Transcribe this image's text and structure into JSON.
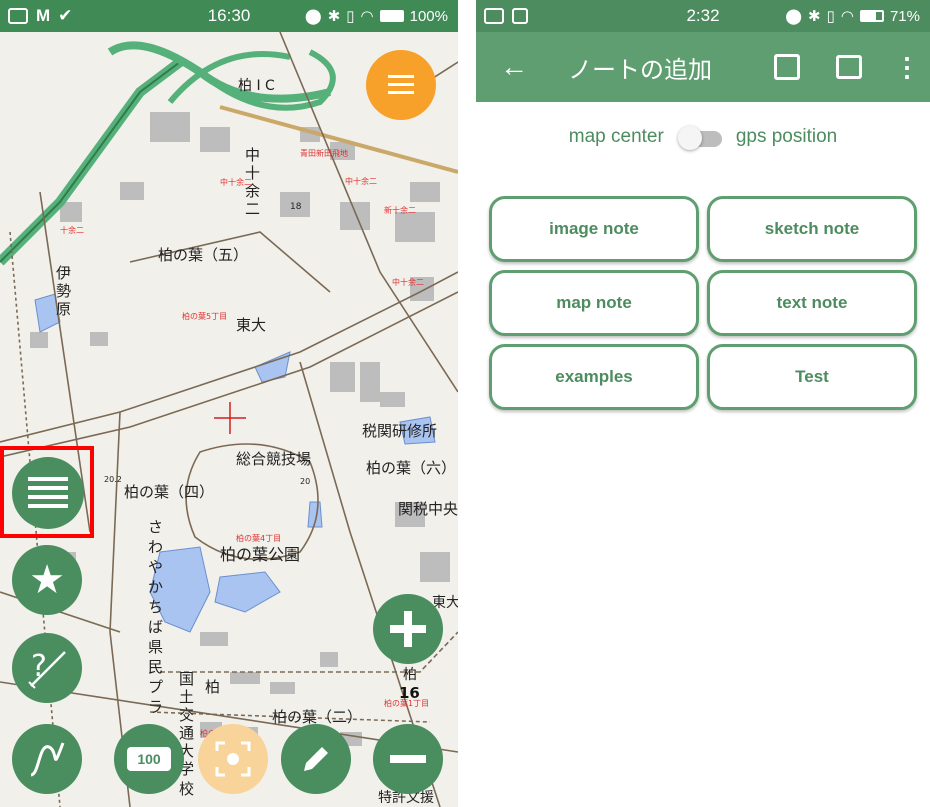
{
  "left_status": {
    "time": "16:30",
    "battery": "100%"
  },
  "map": {
    "labels": {
      "ic": "柏 I C",
      "juyo2": "中\n十\n余\n二",
      "hanoha5": "柏の葉（五）",
      "ise": "伊\n勢\n原",
      "todai": "東大",
      "zeikan": "税関研修所",
      "sogo": "総合競技場",
      "hanoha6": "柏の葉（六）",
      "hanoha4": "柏の葉（四）",
      "kanzei": "関税中央",
      "park": "柏の葉公園",
      "sawayaka": "さわやかちば県民プラザ",
      "kokudo": "国土交通大学校",
      "hanoha2": "柏の葉（二）",
      "tokkyo": "特許文援",
      "kashiwa": "柏",
      "higashi": "東大",
      "elev": "20.2",
      "elev2": "20",
      "n18": "18",
      "zoom": "16",
      "battery_pct": "100"
    },
    "red_labels": [
      "青田新田飛地",
      "中十余二",
      "中十余二",
      "新十余二",
      "十余二",
      "柏の葉5丁目",
      "中十余二",
      "柏の葉4丁目",
      "柏の葉2丁目",
      "柏の葉1丁目"
    ]
  },
  "right_status": {
    "time": "2:32",
    "battery": "71%"
  },
  "appbar": {
    "title": "ノートの追加"
  },
  "toggle": {
    "left_label": "map center",
    "right_label": "gps position",
    "on": false
  },
  "buttons": {
    "image_note": "image note",
    "sketch_note": "sketch note",
    "map_note": "map note",
    "text_note": "text note",
    "examples": "examples",
    "test": "Test"
  },
  "colors": {
    "primary": "#5f9e70",
    "status": "#4d8c5f",
    "fab_orange": "#f7a12b",
    "fab_green": "#4a8d5f",
    "highlight": "#ff0000"
  }
}
